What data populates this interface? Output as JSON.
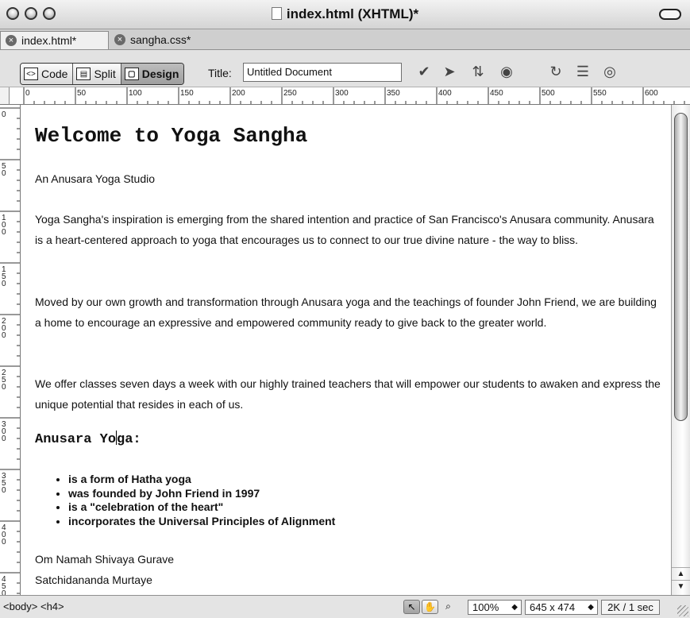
{
  "window": {
    "title": "index.html (XHTML)*"
  },
  "tabs": [
    {
      "label": "index.html*",
      "active": true
    },
    {
      "label": "sangha.css*",
      "active": false
    }
  ],
  "toolbar": {
    "code_label": "Code",
    "split_label": "Split",
    "design_label": "Design",
    "title_label": "Title:",
    "title_value": "Untitled Document"
  },
  "rulers": {
    "horizontal": [
      "0",
      "50",
      "100",
      "150",
      "200",
      "250",
      "300",
      "350",
      "400",
      "450",
      "500",
      "550",
      "600"
    ],
    "vertical": [
      "0",
      "50",
      "100",
      "150",
      "200",
      "250",
      "300",
      "350",
      "400",
      "450"
    ]
  },
  "document": {
    "heading": "Welcome to Yoga Sangha",
    "subtitle": "An Anusara Yoga Studio",
    "para1": "Yoga Sangha's inspiration is emerging from the shared intention and practice of San Francisco's Anusara community. Anusara is a heart-centered approach to yoga that encourages us to connect to our true divine nature - the way to bliss.",
    "para2": "Moved by our own growth and transformation through Anusara yoga and the teachings of founder John Friend, we are building a home to encourage an expressive and empowered community ready to give back to the greater world.",
    "para3": "We offer classes seven days a week with our highly trained teachers that will empower our students to awaken and express the unique potential that resides in each of us.",
    "subheading_a": "Anusara Yo",
    "subheading_b": "ga:",
    "bullets": [
      "is a form of Hatha yoga",
      "was founded by John Friend in 1997",
      "is a \"celebration of the heart\"",
      "incorporates the Universal Principles of Alignment"
    ],
    "closing1": "Om Namah Shivaya Gurave",
    "closing2": "Satchidananda Murtaye"
  },
  "statusbar": {
    "tag_selector": "<body> <h4>",
    "zoom": "100%",
    "window_size": "645 x 474",
    "download": "2K / 1 sec"
  }
}
